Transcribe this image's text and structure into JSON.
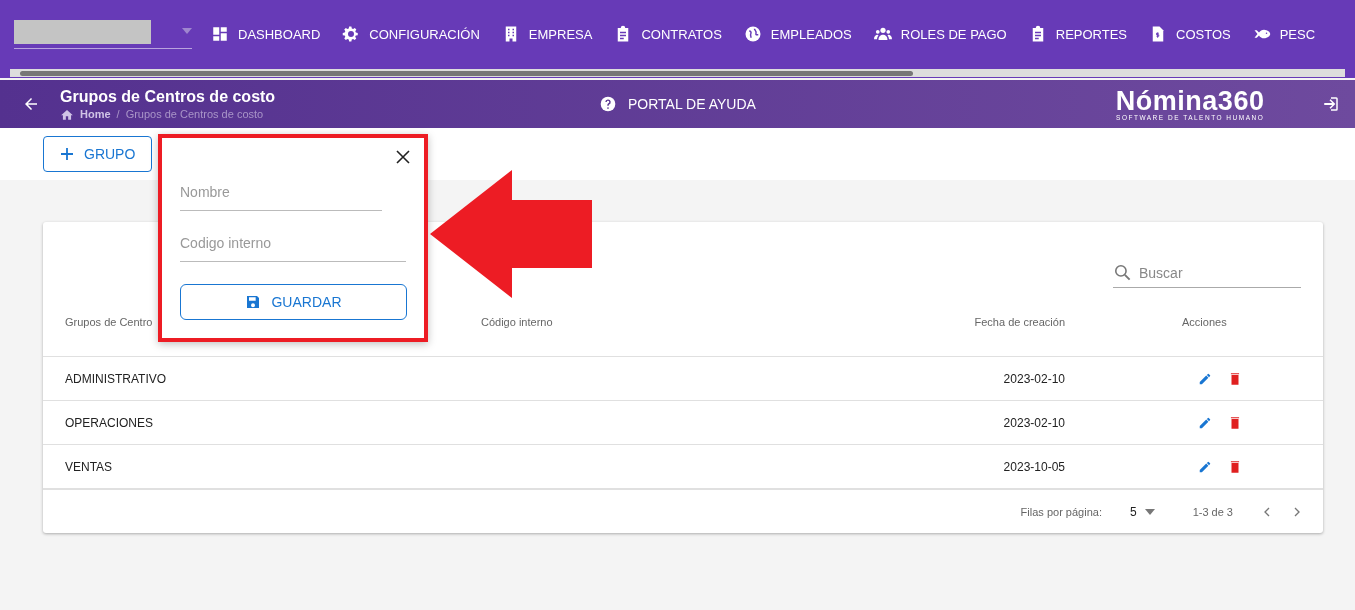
{
  "nav": {
    "items": [
      {
        "label": "DASHBOARD",
        "kind": "dashboard"
      },
      {
        "label": "CONFIGURACIÓN",
        "kind": "gear"
      },
      {
        "label": "EMPRESA",
        "kind": "building"
      },
      {
        "label": "CONTRATOS",
        "kind": "clipboard"
      },
      {
        "label": "EMPLEADOS",
        "kind": "globe"
      },
      {
        "label": "ROLES DE PAGO",
        "kind": "people"
      },
      {
        "label": "REPORTES",
        "kind": "clipboard"
      },
      {
        "label": "COSTOS",
        "kind": "invoice"
      },
      {
        "label": "PESC",
        "kind": "fish"
      }
    ]
  },
  "header": {
    "title": "Grupos de Centros de costo",
    "breadcrumb": [
      "Home",
      "/",
      "Grupos de Centros de costo"
    ],
    "help": "PORTAL DE AYUDA",
    "logo": {
      "name": "Nómina360",
      "tagline": "SOFTWARE DE TALENTO HUMANO"
    }
  },
  "add_button": "GRUPO",
  "popup": {
    "fields": [
      {
        "placeholder": "Nombre"
      },
      {
        "placeholder": "Codigo interno"
      }
    ],
    "save": "GUARDAR"
  },
  "search": {
    "placeholder": "Buscar"
  },
  "table": {
    "columns": [
      "Grupos de Centro",
      "Código interno",
      "Fecha de creación",
      "Acciones"
    ],
    "rows": [
      {
        "name": "ADMINISTRATIVO",
        "date": "2023-02-10"
      },
      {
        "name": "OPERACIONES",
        "date": "2023-02-10"
      },
      {
        "name": "VENTAS",
        "date": "2023-10-05"
      }
    ]
  },
  "pagination": {
    "label": "Filas por página:",
    "rows_per_page": "5",
    "range": "1-3 de 3"
  }
}
